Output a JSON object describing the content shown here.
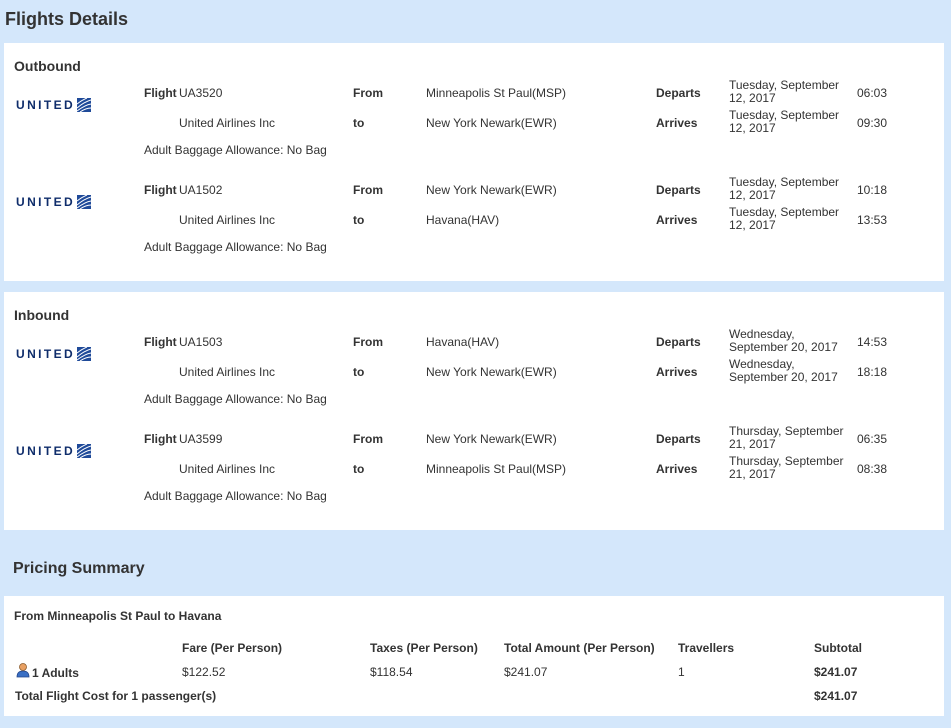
{
  "page": {
    "title": "Flights Details"
  },
  "labels": {
    "flight": "Flight",
    "from": "From",
    "to": "to",
    "departs": "Departs",
    "arrives": "Arrives",
    "airline_logo": "UNITED"
  },
  "outbound": {
    "title": "Outbound",
    "legs": [
      {
        "flight": "UA3520",
        "airline": "United Airlines Inc",
        "from": "Minneapolis St Paul(MSP)",
        "to": "New York Newark(EWR)",
        "depart_date_1": "Tuesday, September",
        "depart_date_2": "12, 2017",
        "depart_time": "06:03",
        "arrive_date_1": "Tuesday, September",
        "arrive_date_2": "12, 2017",
        "arrive_time": "09:30",
        "baggage": "Adult Baggage Allowance: No Bag"
      },
      {
        "flight": "UA1502",
        "airline": "United Airlines Inc",
        "from": "New York Newark(EWR)",
        "to": "Havana(HAV)",
        "depart_date_1": "Tuesday, September",
        "depart_date_2": "12, 2017",
        "depart_time": "10:18",
        "arrive_date_1": "Tuesday, September",
        "arrive_date_2": "12, 2017",
        "arrive_time": "13:53",
        "baggage": "Adult Baggage Allowance: No Bag"
      }
    ]
  },
  "inbound": {
    "title": "Inbound",
    "legs": [
      {
        "flight": "UA1503",
        "airline": "United Airlines Inc",
        "from": "Havana(HAV)",
        "to": "New York Newark(EWR)",
        "depart_date_1": "Wednesday,",
        "depart_date_2": "September 20, 2017",
        "depart_time": "14:53",
        "arrive_date_1": "Wednesday,",
        "arrive_date_2": "September 20, 2017",
        "arrive_time": "18:18",
        "baggage": "Adult Baggage Allowance: No Bag"
      },
      {
        "flight": "UA3599",
        "airline": "United Airlines Inc",
        "from": "New York Newark(EWR)",
        "to": "Minneapolis St Paul(MSP)",
        "depart_date_1": "Thursday, September",
        "depart_date_2": "21, 2017",
        "depart_time": "06:35",
        "arrive_date_1": "Thursday, September",
        "arrive_date_2": "21, 2017",
        "arrive_time": "08:38",
        "baggage": "Adult Baggage Allowance: No Bag"
      }
    ]
  },
  "pricing": {
    "title": "Pricing Summary",
    "route": "From Minneapolis St Paul to Havana",
    "headers": {
      "fare": "Fare (Per Person)",
      "taxes": "Taxes (Per Person)",
      "total": "Total Amount (Per Person)",
      "travellers": "Travellers",
      "subtotal": "Subtotal"
    },
    "row": {
      "passengers": "1 Adults",
      "fare": "$122.52",
      "taxes": "$118.54",
      "total": "$241.07",
      "travellers": "1",
      "subtotal": "$241.07"
    },
    "grand_total_label": "Total Flight Cost for 1 passenger(s)",
    "grand_total": "$241.07"
  },
  "colors": {
    "page_bg": "#d4e7fb",
    "panel_bg": "#ffffff",
    "united_blue": "#0f2d6b"
  },
  "icons": {
    "airline_logo": "united-globe-icon",
    "passenger": "person-icon"
  }
}
